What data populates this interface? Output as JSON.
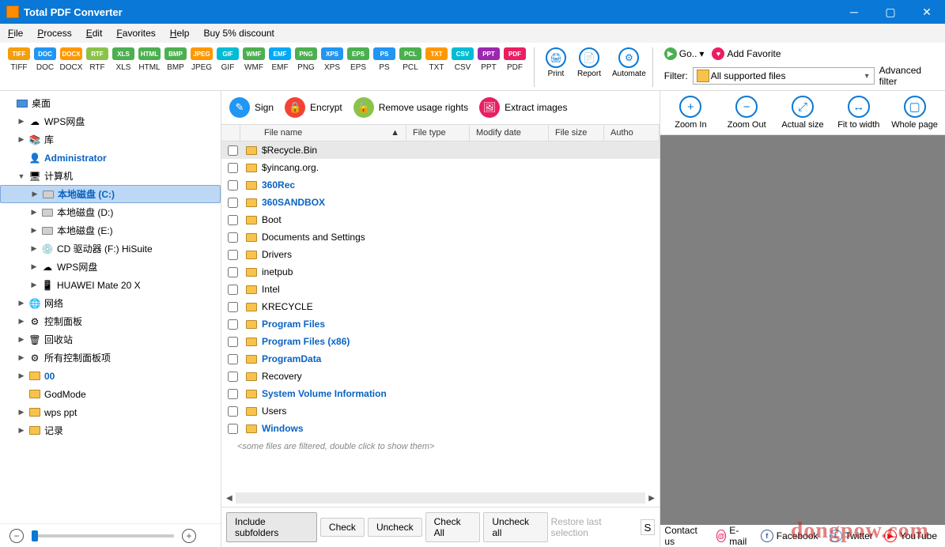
{
  "app": {
    "title": "Total PDF Converter"
  },
  "menu": [
    "File",
    "Process",
    "Edit",
    "Favorites",
    "Help",
    "Buy 5% discount"
  ],
  "formats": [
    {
      "label": "TIFF",
      "color": "#f59e0b"
    },
    {
      "label": "DOC",
      "color": "#2196f3"
    },
    {
      "label": "DOCX",
      "color": "#ff9800"
    },
    {
      "label": "RTF",
      "color": "#8bc34a"
    },
    {
      "label": "XLS",
      "color": "#4caf50"
    },
    {
      "label": "HTML",
      "color": "#4caf50"
    },
    {
      "label": "BMP",
      "color": "#4caf50"
    },
    {
      "label": "JPEG",
      "color": "#ff9800"
    },
    {
      "label": "GIF",
      "color": "#00bcd4"
    },
    {
      "label": "WMF",
      "color": "#4caf50"
    },
    {
      "label": "EMF",
      "color": "#03a9f4"
    },
    {
      "label": "PNG",
      "color": "#4caf50"
    },
    {
      "label": "XPS",
      "color": "#2196f3"
    },
    {
      "label": "EPS",
      "color": "#4caf50"
    },
    {
      "label": "PS",
      "color": "#2196f3"
    },
    {
      "label": "PCL",
      "color": "#4caf50"
    },
    {
      "label": "TXT",
      "color": "#ff9800"
    },
    {
      "label": "CSV",
      "color": "#00bcd4"
    },
    {
      "label": "PPT",
      "color": "#9c27b0"
    },
    {
      "label": "PDF",
      "color": "#e91e63"
    }
  ],
  "bigtools": [
    {
      "label": "Print",
      "icon": "🖨"
    },
    {
      "label": "Report",
      "icon": "📄"
    },
    {
      "label": "Automate",
      "icon": "⚙"
    }
  ],
  "go_label": "Go..",
  "addfav_label": "Add Favorite",
  "filter_label": "Filter:",
  "filter_value": "All supported files",
  "advfilter": "Advanced filter",
  "actions": [
    {
      "label": "Sign",
      "color": "#2196f3",
      "icon": "✎"
    },
    {
      "label": "Encrypt",
      "color": "#f44336",
      "icon": "🔒"
    },
    {
      "label": "Remove usage rights",
      "color": "#8bc34a",
      "icon": "🔓"
    },
    {
      "label": "Extract images",
      "color": "#e91e63",
      "icon": "🖼"
    }
  ],
  "columns": {
    "name": "File name",
    "type": "File type",
    "date": "Modify date",
    "size": "File size",
    "author": "Autho"
  },
  "tree": [
    {
      "indent": 0,
      "arrow": "",
      "icon": "monitor",
      "text": "桌面",
      "blue": false
    },
    {
      "indent": 1,
      "arrow": "▶",
      "icon": "cloud",
      "text": "WPS网盘",
      "blue": false
    },
    {
      "indent": 1,
      "arrow": "▶",
      "icon": "lib",
      "text": "库",
      "blue": false
    },
    {
      "indent": 1,
      "arrow": "",
      "icon": "user",
      "text": "Administrator",
      "blue": true
    },
    {
      "indent": 1,
      "arrow": "▼",
      "icon": "pc",
      "text": "计算机",
      "blue": false
    },
    {
      "indent": 2,
      "arrow": "▶",
      "icon": "drive",
      "text": "本地磁盘 (C:)",
      "blue": true,
      "sel": true
    },
    {
      "indent": 2,
      "arrow": "▶",
      "icon": "drive",
      "text": "本地磁盘 (D:)",
      "blue": false
    },
    {
      "indent": 2,
      "arrow": "▶",
      "icon": "drive",
      "text": "本地磁盘 (E:)",
      "blue": false
    },
    {
      "indent": 2,
      "arrow": "▶",
      "icon": "cd",
      "text": "CD 驱动器 (F:) HiSuite",
      "blue": false
    },
    {
      "indent": 2,
      "arrow": "▶",
      "icon": "cloud",
      "text": "WPS网盘",
      "blue": false
    },
    {
      "indent": 2,
      "arrow": "▶",
      "icon": "phone",
      "text": "HUAWEI Mate 20 X",
      "blue": false
    },
    {
      "indent": 1,
      "arrow": "▶",
      "icon": "net",
      "text": "网络",
      "blue": false
    },
    {
      "indent": 1,
      "arrow": "▶",
      "icon": "panel",
      "text": "控制面板",
      "blue": false
    },
    {
      "indent": 1,
      "arrow": "▶",
      "icon": "bin",
      "text": "回收站",
      "blue": false
    },
    {
      "indent": 1,
      "arrow": "▶",
      "icon": "panel",
      "text": "所有控制面板项",
      "blue": false
    },
    {
      "indent": 1,
      "arrow": "▶",
      "icon": "folder",
      "text": "00",
      "blue": true
    },
    {
      "indent": 1,
      "arrow": "",
      "icon": "folder",
      "text": "GodMode",
      "blue": false
    },
    {
      "indent": 1,
      "arrow": "▶",
      "icon": "folder",
      "text": "wps ppt",
      "blue": false
    },
    {
      "indent": 1,
      "arrow": "▶",
      "icon": "folder",
      "text": "记录",
      "blue": false
    }
  ],
  "files": [
    {
      "name": "$Recycle.Bin",
      "blue": false,
      "sel": true
    },
    {
      "name": "$yincang.org.",
      "blue": false
    },
    {
      "name": "360Rec",
      "blue": true
    },
    {
      "name": "360SANDBOX",
      "blue": true
    },
    {
      "name": "Boot",
      "blue": false
    },
    {
      "name": "Documents and Settings",
      "blue": false
    },
    {
      "name": "Drivers",
      "blue": false
    },
    {
      "name": "inetpub",
      "blue": false
    },
    {
      "name": "Intel",
      "blue": false
    },
    {
      "name": "KRECYCLE",
      "blue": false
    },
    {
      "name": "Program Files",
      "blue": true
    },
    {
      "name": "Program Files (x86)",
      "blue": true
    },
    {
      "name": "ProgramData",
      "blue": true
    },
    {
      "name": "Recovery",
      "blue": false
    },
    {
      "name": "System Volume Information",
      "blue": true
    },
    {
      "name": "Users",
      "blue": false
    },
    {
      "name": "Windows",
      "blue": true
    }
  ],
  "filtered_note": "<some files are filtered, double click to show them>",
  "bottom": {
    "include": "Include subfolders",
    "check": "Check",
    "uncheck": "Uncheck",
    "checkall": "Check All",
    "uncheckall": "Uncheck all",
    "restore": "Restore last selection",
    "s": "S"
  },
  "preview_tools": [
    {
      "label": "Zoom In",
      "icon": "+"
    },
    {
      "label": "Zoom Out",
      "icon": "−"
    },
    {
      "label": "Actual size",
      "icon": "⤢"
    },
    {
      "label": "Fit to width",
      "icon": "↔"
    },
    {
      "label": "Whole page",
      "icon": "▢"
    }
  ],
  "footer": {
    "contact": "Contact us",
    "email": "E-mail",
    "fb": "Facebook",
    "tw": "Twitter",
    "yt": "YouTube"
  },
  "watermark": "dongpow.com"
}
